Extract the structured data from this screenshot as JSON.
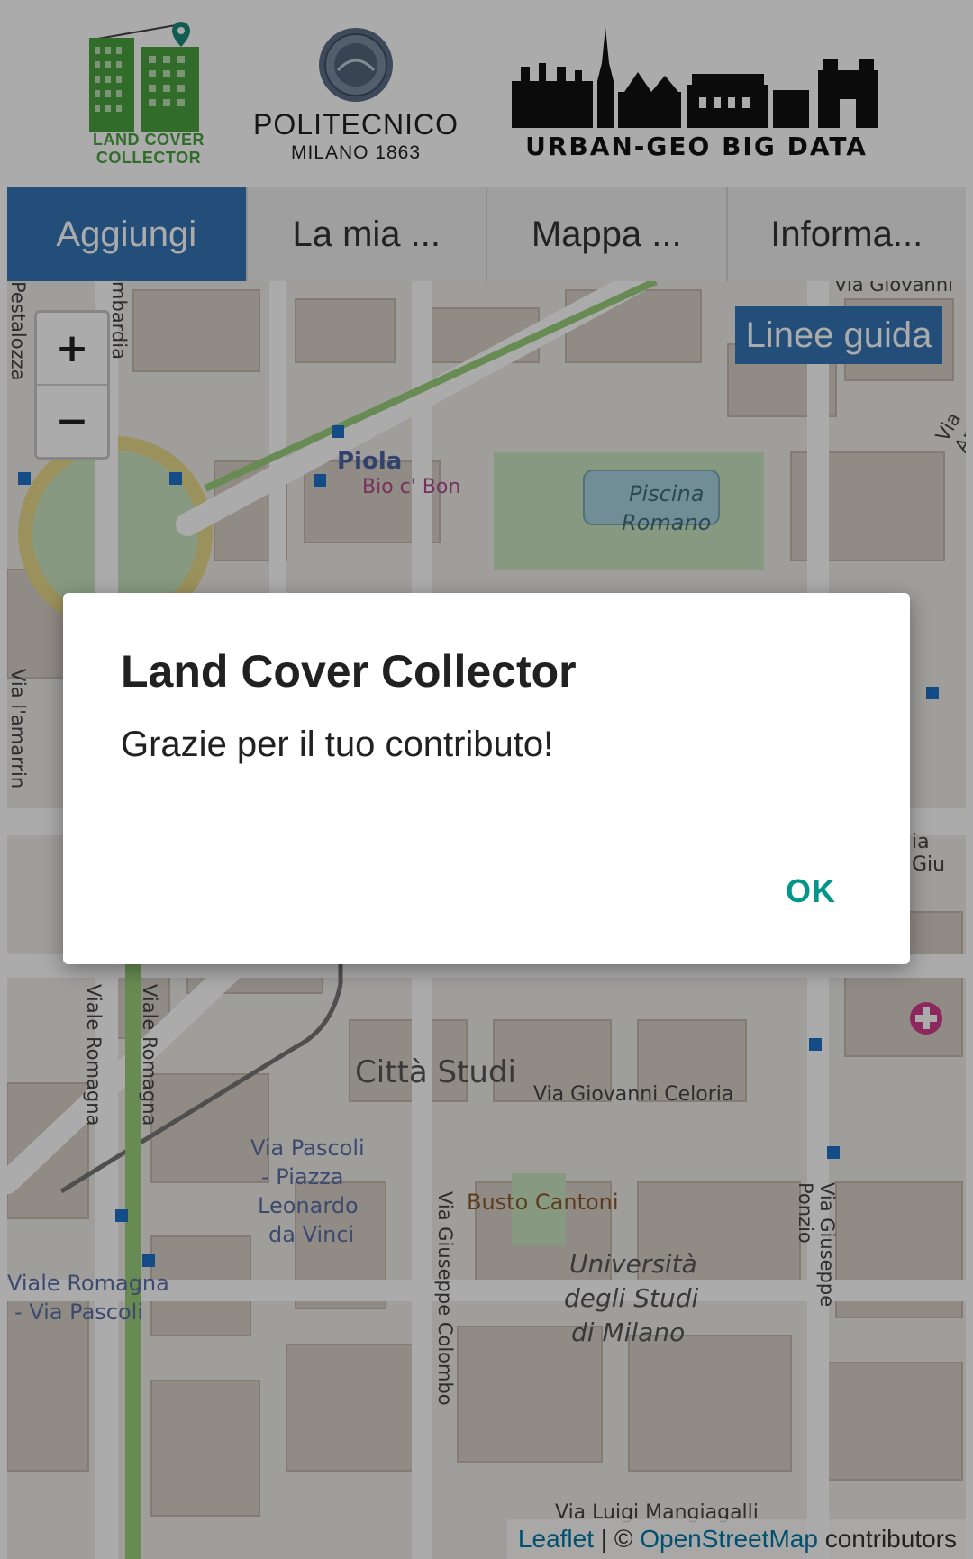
{
  "header": {
    "lcc_logo": {
      "line1": "LAND COVER",
      "line2": "COLLECTOR"
    },
    "polimi_logo": {
      "line1": "POLITECNICO",
      "line2": "MILANO 1863"
    },
    "urban_logo": {
      "text": "URBAN-GEO BIG DATA"
    }
  },
  "tabs": [
    {
      "label": "Aggiungi",
      "active": true
    },
    {
      "label": "La mia ...",
      "active": false
    },
    {
      "label": "Mappa ...",
      "active": false
    },
    {
      "label": "Informa...",
      "active": false
    }
  ],
  "map": {
    "zoom_in": "+",
    "zoom_out": "−",
    "guidelines_button": "Linee guida",
    "labels": {
      "piola": "Piola",
      "bio_c_bon": "Bio c' Bon",
      "piscina_1": "Piscina",
      "piscina_2": "Romano",
      "citta_studi": "Città Studi",
      "via_celoria": "Via Giovanni Celoria",
      "via_pascoli_1": "Via Pascoli",
      "via_pascoli_2": "- Piazza",
      "via_pascoli_3": "Leonardo",
      "via_pascoli_4": "da Vinci",
      "viale_romagna_1": "Viale Romagna",
      "viale_romagna_2": "- Via Pascoli",
      "busto_cantoni": "Busto Cantoni",
      "unimi_1": "Università",
      "unimi_2": "degli Studi",
      "unimi_3": "di Milano",
      "via_mangiagalli": "Via Luigi Mangiagalli",
      "viale_romagna_v1": "Viale Romagna",
      "viale_romagna_v2": "Viale Romagna",
      "via_colombo": "Via Giuseppe Colombo",
      "via_ponzio": "Via Giuseppe Ponzio",
      "via_pestalozza": "Pestalozza",
      "via_lombardia": "mbardia",
      "via_giovanni_top": "Via Giovanni",
      "via_ant": "Via Ant",
      "via_amarrin": "Via l'amarrin",
      "via_giu": "ia Giu"
    },
    "attribution": {
      "leaflet": "Leaflet",
      "separator": " | © ",
      "osm": "OpenStreetMap",
      "suffix": " contributors"
    }
  },
  "dialog": {
    "title": "Land Cover Collector",
    "message": "Grazie per il tuo contributo!",
    "ok_label": "OK"
  },
  "colors": {
    "accent_blue": "#3375b5",
    "dialog_ok": "#00968a",
    "logo_green": "#49a23f"
  }
}
